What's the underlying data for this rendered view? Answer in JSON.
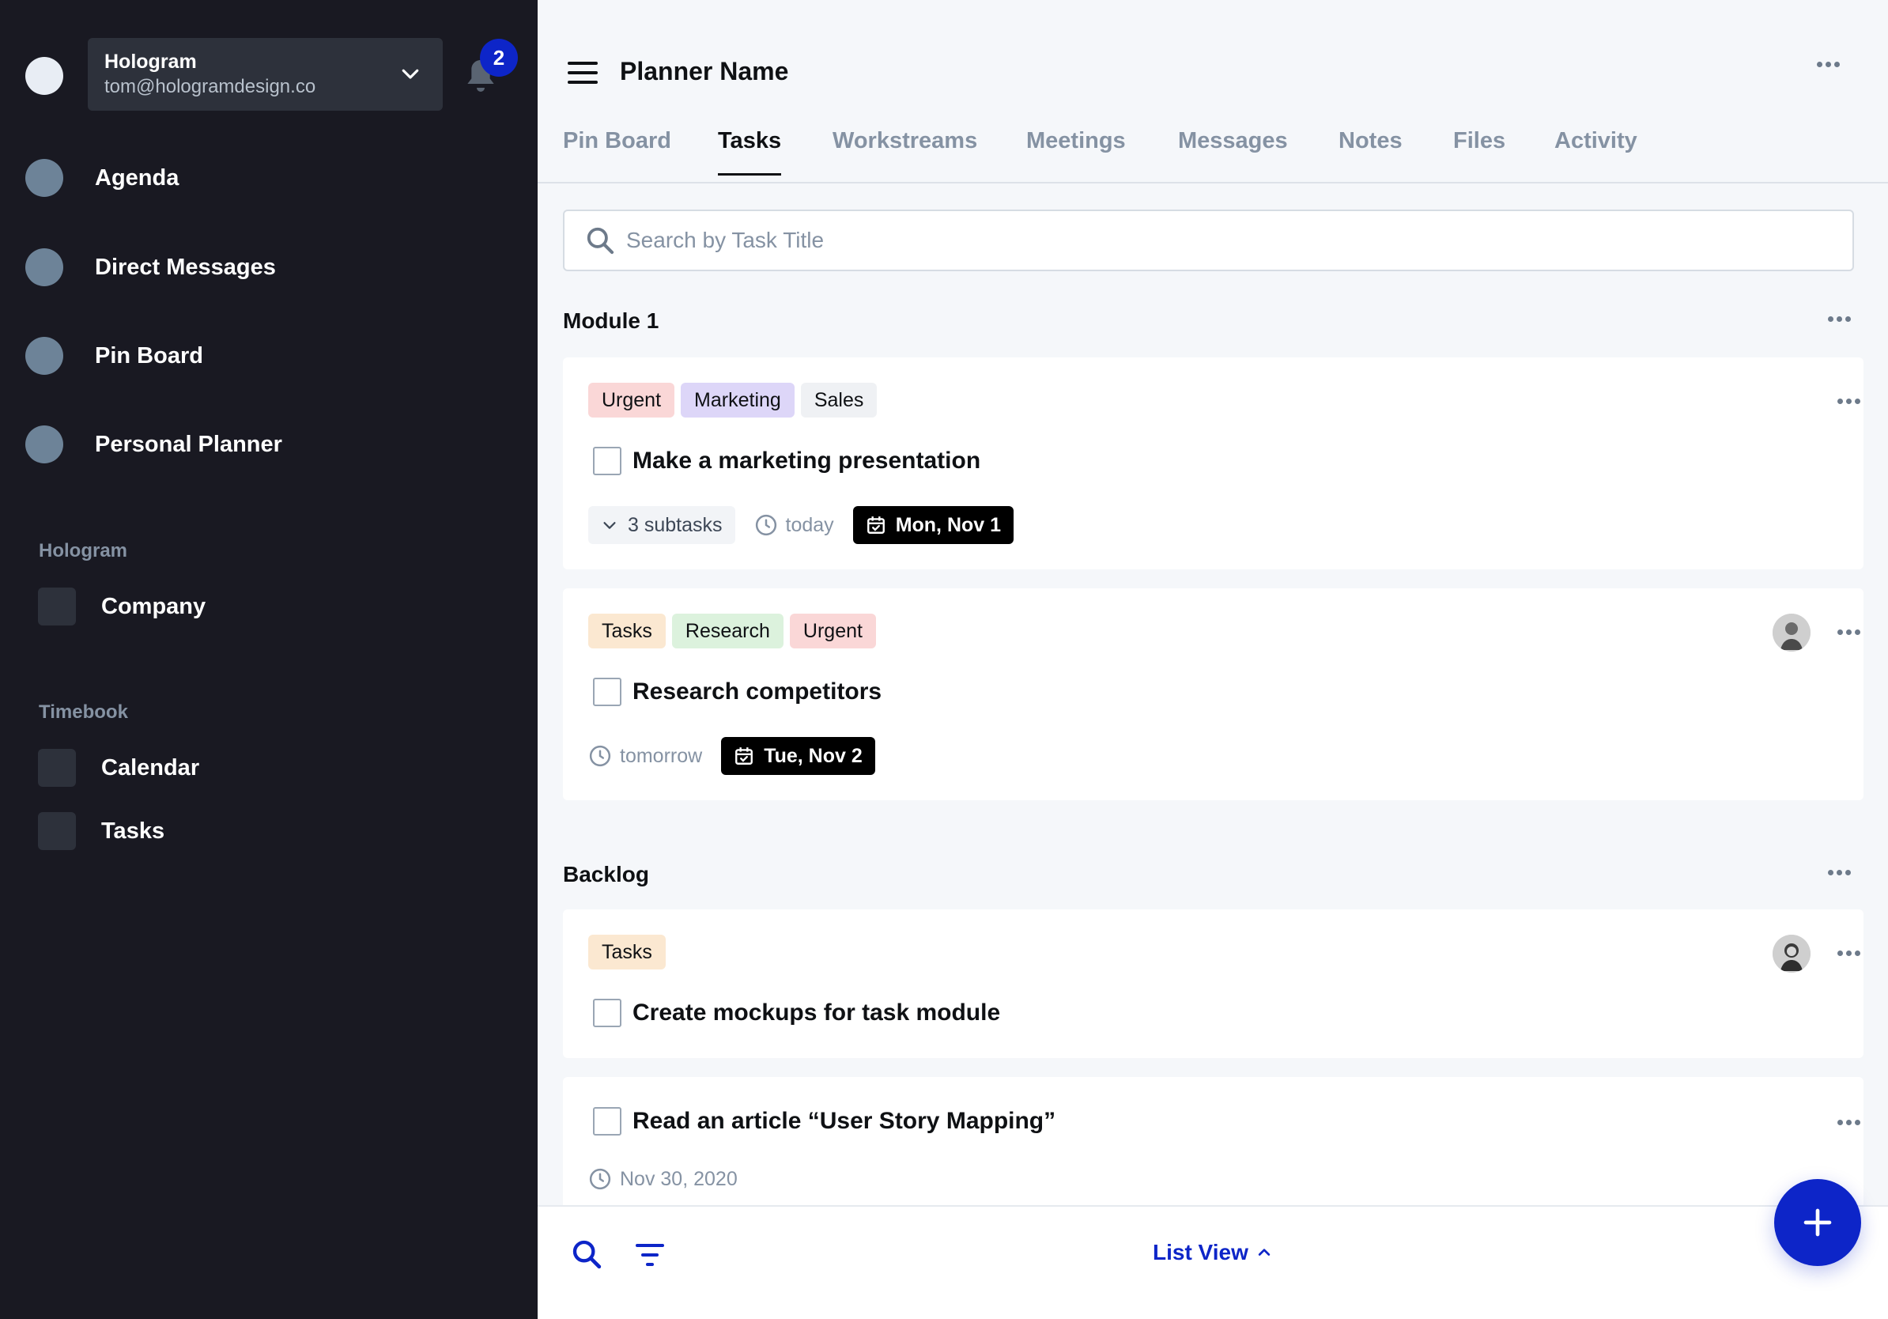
{
  "account": {
    "name": "Hologram",
    "email": "tom@hologramdesign.co"
  },
  "notifications": {
    "count": "2"
  },
  "sidebar": {
    "nav": [
      {
        "label": "Agenda"
      },
      {
        "label": "Direct Messages"
      },
      {
        "label": "Pin Board"
      },
      {
        "label": "Personal Planner"
      }
    ],
    "sections": [
      {
        "title": "Hologram",
        "items": [
          {
            "label": "Company"
          }
        ]
      },
      {
        "title": "Timebook",
        "items": [
          {
            "label": "Calendar"
          },
          {
            "label": "Tasks"
          }
        ]
      }
    ]
  },
  "header": {
    "title": "Planner Name"
  },
  "tabs": [
    {
      "label": "Pin Board"
    },
    {
      "label": "Tasks",
      "active": true
    },
    {
      "label": "Workstreams"
    },
    {
      "label": "Meetings"
    },
    {
      "label": "Messages"
    },
    {
      "label": "Notes"
    },
    {
      "label": "Files"
    },
    {
      "label": "Activity"
    }
  ],
  "search": {
    "placeholder": "Search by Task Title",
    "value": ""
  },
  "groups": [
    {
      "title": "Module 1",
      "tasks": [
        {
          "tags": [
            "Urgent",
            "Marketing",
            "Sales"
          ],
          "title": "Make a marketing presentation",
          "subtasks": "3 subtasks",
          "time": "today",
          "date": "Mon, Nov 1"
        },
        {
          "tags": [
            "Tasks",
            "Research",
            "Urgent"
          ],
          "title": "Research competitors",
          "time": "tomorrow",
          "date": "Tue, Nov 2"
        }
      ]
    },
    {
      "title": "Backlog",
      "tasks": [
        {
          "tags": [
            "Tasks"
          ],
          "title": "Create mockups for task module"
        },
        {
          "title": "Read an article “User Story Mapping”",
          "time": "Nov 30, 2020"
        }
      ]
    }
  ],
  "bottom_bar": {
    "view_label": "List View"
  },
  "colors": {
    "sidebar_bg": "#191922",
    "accent": "#0d25c8",
    "tag_urgent": "#fad7d7",
    "tag_marketing": "#ddd6f8",
    "tag_sales": "#eff1f4",
    "tag_tasks": "#fbe8d1",
    "tag_research": "#dcf2dd"
  },
  "icons": [
    "menu-icon",
    "bell-icon",
    "chevron-down-icon",
    "search-icon",
    "clock-icon",
    "calendar-check-icon",
    "filter-icon",
    "chevron-up-icon",
    "plus-icon",
    "more-icon"
  ]
}
